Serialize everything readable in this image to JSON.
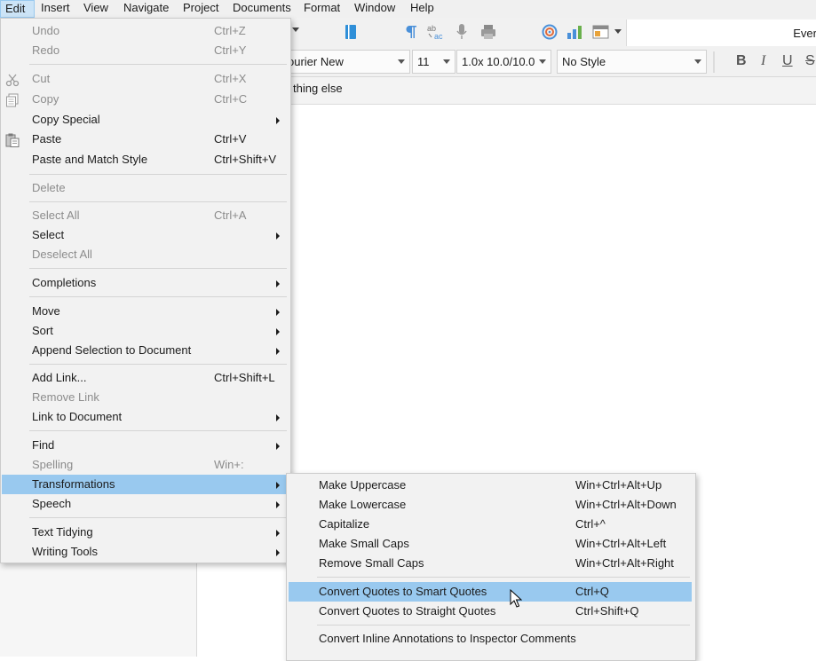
{
  "menubar": {
    "items": [
      "Edit",
      "Insert",
      "View",
      "Navigate",
      "Project",
      "Documents",
      "Format",
      "Window",
      "Help"
    ]
  },
  "toolbar": {
    "right_text": "Ever",
    "font_family": "ourier New",
    "font_size": "11",
    "line_spacing": "1.0x 10.0/10.0",
    "style": "No Style",
    "bold": "B",
    "italic": "I",
    "underline": "U",
    "strike": "S",
    "icons": [
      "dropdown-arrow-icon",
      "notebook-icon",
      "paragraph-icon",
      "ab-ac-replace-icon",
      "microphone-icon",
      "printer-icon",
      "target-icon",
      "bar-chart-icon",
      "layout-icon"
    ]
  },
  "header": {
    "text": "thing else"
  },
  "edit_menu": {
    "items": [
      {
        "label": "Undo",
        "shortcut": "Ctrl+Z",
        "disabled": true
      },
      {
        "label": "Redo",
        "shortcut": "Ctrl+Y",
        "disabled": true
      },
      {
        "label": "Cut",
        "shortcut": "Ctrl+X",
        "disabled": true,
        "icon": "scissors-icon"
      },
      {
        "label": "Copy",
        "shortcut": "Ctrl+C",
        "disabled": true,
        "icon": "copy-icon"
      },
      {
        "label": "Copy Special",
        "submenu": true
      },
      {
        "label": "Paste",
        "shortcut": "Ctrl+V",
        "icon": "clipboard-icon"
      },
      {
        "label": "Paste and Match Style",
        "shortcut": "Ctrl+Shift+V"
      },
      {
        "label": "Delete",
        "disabled": true
      },
      {
        "label": "Select All",
        "shortcut": "Ctrl+A",
        "disabled": true
      },
      {
        "label": "Select",
        "submenu": true
      },
      {
        "label": "Deselect All",
        "disabled": true
      },
      {
        "label": "Completions",
        "submenu": true
      },
      {
        "label": "Move",
        "submenu": true
      },
      {
        "label": "Sort",
        "submenu": true
      },
      {
        "label": "Append Selection to Document",
        "submenu": true
      },
      {
        "label": "Add Link...",
        "shortcut": "Ctrl+Shift+L"
      },
      {
        "label": "Remove Link",
        "disabled": true
      },
      {
        "label": "Link to Document",
        "submenu": true
      },
      {
        "label": "Find",
        "submenu": true
      },
      {
        "label": "Spelling",
        "shortcut": "Win+:",
        "disabled": true
      },
      {
        "label": "Transformations",
        "submenu": true,
        "highlighted": true
      },
      {
        "label": "Speech",
        "submenu": true
      },
      {
        "label": "Text Tidying",
        "submenu": true
      },
      {
        "label": "Writing Tools",
        "submenu": true
      }
    ]
  },
  "transform_menu": {
    "items": [
      {
        "label": "Make Uppercase",
        "shortcut": "Win+Ctrl+Alt+Up"
      },
      {
        "label": "Make Lowercase",
        "shortcut": "Win+Ctrl+Alt+Down"
      },
      {
        "label": "Capitalize",
        "shortcut": "Ctrl+^"
      },
      {
        "label": "Make Small Caps",
        "shortcut": "Win+Ctrl+Alt+Left"
      },
      {
        "label": "Remove Small Caps",
        "shortcut": "Win+Ctrl+Alt+Right"
      },
      {
        "label": "Convert Quotes to Smart Quotes",
        "shortcut": "Ctrl+Q",
        "highlighted": true
      },
      {
        "label": "Convert Quotes to Straight Quotes",
        "shortcut": "Ctrl+Shift+Q"
      },
      {
        "label": "Convert Inline Annotations to Inspector Comments",
        "shortcut": ""
      }
    ]
  },
  "colors": {
    "highlight": "#99c9ef",
    "menubar_active": "#cce4f7",
    "menu_bg": "#f2f2f2",
    "disabled_text": "#8c8c8c"
  }
}
